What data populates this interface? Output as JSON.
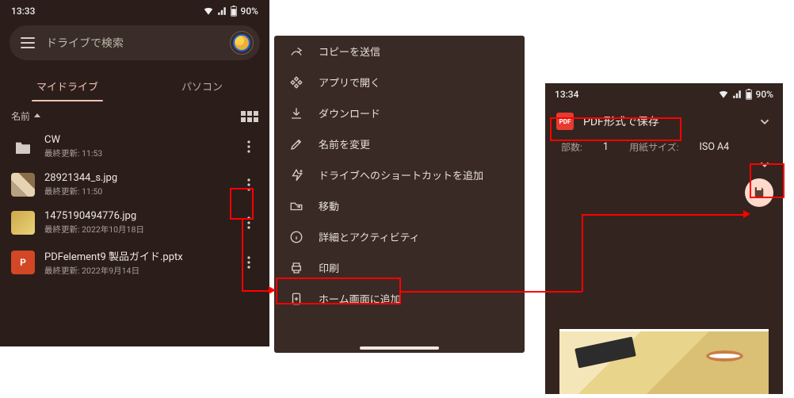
{
  "colors": {
    "bg_dark": "#2b1d1a",
    "menu_bg": "#392a26",
    "print_bg": "#33241f",
    "accent_red": "#ff0000",
    "pdf_red": "#e73b2f",
    "fab": "#ffd9cc"
  },
  "screen1": {
    "status": {
      "time": "13:33",
      "battery": "90%"
    },
    "search_placeholder": "ドライブで検索",
    "tabs": {
      "active": "マイドライブ",
      "other": "パソコン"
    },
    "sort_label": "名前",
    "files": [
      {
        "name": "CW",
        "meta": "最終更新: 11:53",
        "kind": "folder"
      },
      {
        "name": "28921344_s.jpg",
        "meta": "最終更新: 11:50",
        "kind": "img1"
      },
      {
        "name": "1475190494776.jpg",
        "meta": "最終更新: 2022年10月18日",
        "kind": "img2"
      },
      {
        "name": "PDFelement9 製品ガイド.pptx",
        "meta": "最終更新: 2022年9月14日",
        "kind": "pptx"
      }
    ]
  },
  "screen2": {
    "menu": [
      {
        "icon": "send-copy-icon",
        "label": "コピーを送信"
      },
      {
        "icon": "open-with-icon",
        "label": "アプリで開く"
      },
      {
        "icon": "download-icon",
        "label": "ダウンロード"
      },
      {
        "icon": "rename-icon",
        "label": "名前を変更"
      },
      {
        "icon": "add-shortcut-icon",
        "label": "ドライブへのショートカットを追加"
      },
      {
        "icon": "move-icon",
        "label": "移動"
      },
      {
        "icon": "details-icon",
        "label": "詳細とアクティビティ"
      },
      {
        "icon": "print-icon",
        "label": "印刷"
      },
      {
        "icon": "add-home-icon",
        "label": "ホーム画面に追加"
      }
    ]
  },
  "screen3": {
    "status": {
      "time": "13:34",
      "battery": "90%"
    },
    "destination": "PDF形式で保存",
    "copies_label": "部数:",
    "copies_value": "1",
    "paper_label": "用紙サイズ:",
    "paper_value": "ISO A4"
  }
}
